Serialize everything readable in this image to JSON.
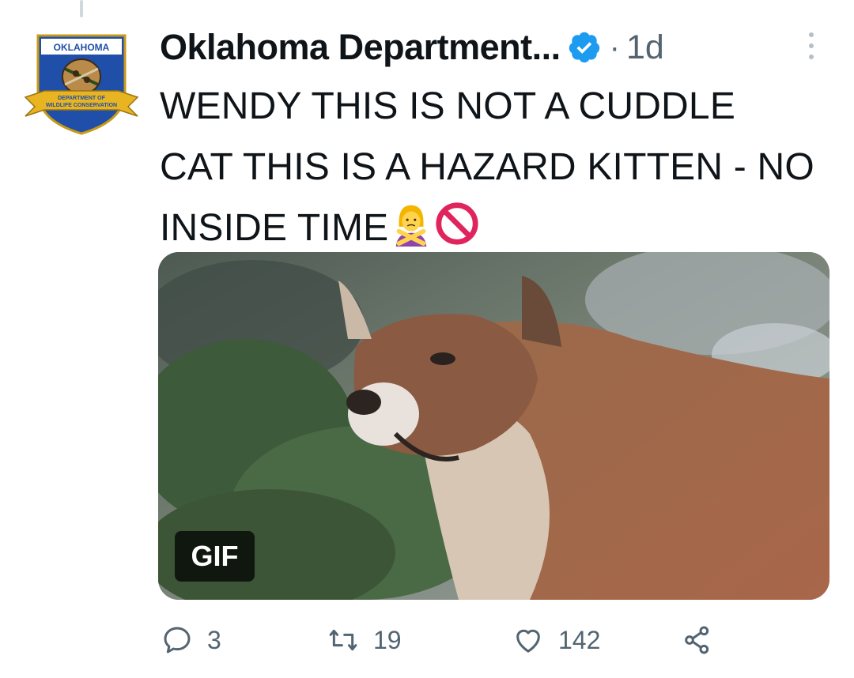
{
  "tweet": {
    "author_name": "Oklahoma Department...",
    "verified_icon": "verified-badge-icon",
    "separator": "·",
    "timestamp": "1d",
    "text": "WENDY THIS IS NOT A CUDDLE CAT THIS IS A HAZARD KITTEN - NO INSIDE TIME",
    "emojis": [
      "person-gesturing-no-emoji",
      "prohibited-emoji"
    ]
  },
  "avatar": {
    "logo_top_text": "OKLAHOMA",
    "logo_banner_text": "DEPARTMENT OF WILDLIFE CONSERVATION"
  },
  "media": {
    "badge": "GIF",
    "description_icon": "cougar-gif"
  },
  "actions": {
    "reply_count": "3",
    "retweet_count": "19",
    "like_count": "142"
  },
  "colors": {
    "text": "#0f1419",
    "secondary": "#536471",
    "verified": "#1d9bf0",
    "shield": "#1f4fa8",
    "banner": "#e8b422"
  }
}
